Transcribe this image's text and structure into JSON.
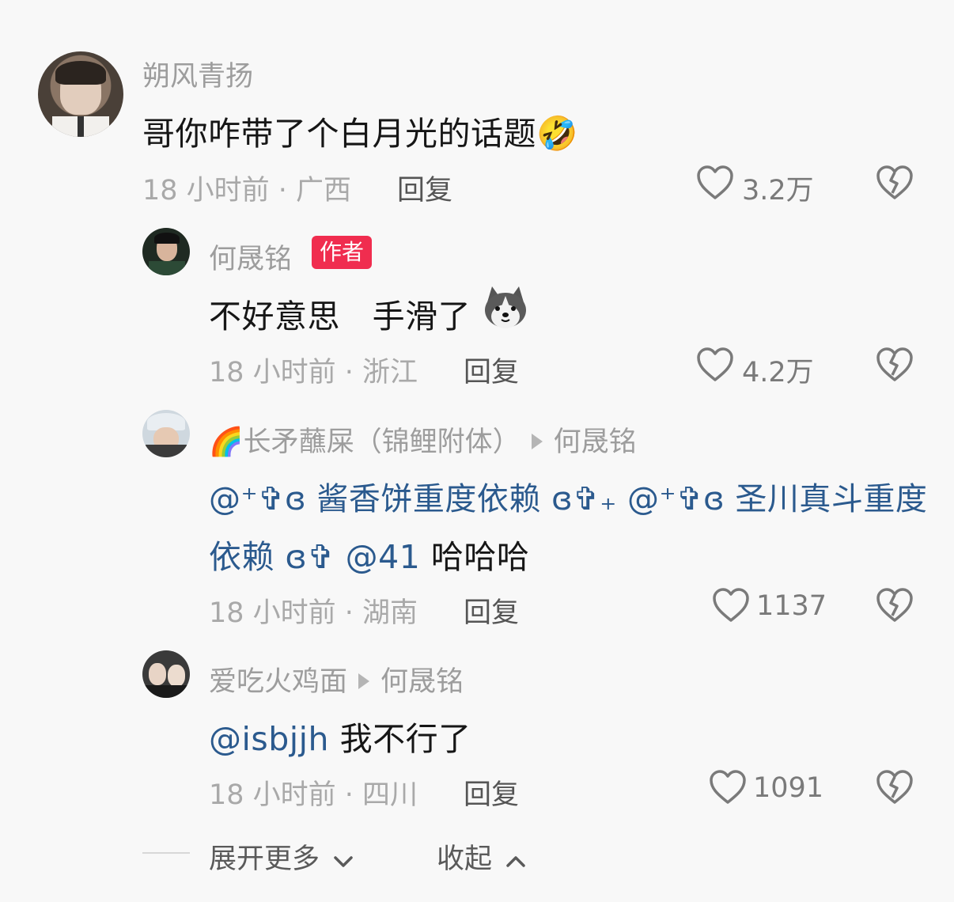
{
  "comments": [
    {
      "username": "朔风青扬",
      "text": "哥你咋带了个白月光的话题",
      "emoji": "🤣",
      "time_location": "18 小时前 · 广西",
      "reply_label": "回复",
      "likes": "3.2万",
      "replies": [
        {
          "username": "何晟铭",
          "badge": "作者",
          "text": "不好意思   手滑了",
          "time_location": "18 小时前 · 浙江",
          "reply_label": "回复",
          "likes": "4.2万"
        },
        {
          "user_prefix_emoji": "🌈",
          "username": "长矛蘸屎（锦鲤附体）",
          "reply_to": "何晟铭",
          "text_line1": "@⁺✞ɞ 酱香饼重度依赖 ɞ✞₊ @⁺✞ɞ 圣川真斗重度",
          "text_line2_mention": "依赖 ɞ✞ @41",
          "text_line2_rest": " 哈哈哈",
          "time_location": "18 小时前 · 湖南",
          "reply_label": "回复",
          "likes": "1137"
        },
        {
          "username": "爱吃火鸡面",
          "reply_to": "何晟铭",
          "mention": "@isbjjh",
          "text": " 我不行了",
          "time_location": "18 小时前 · 四川",
          "reply_label": "回复",
          "likes": "1091"
        }
      ]
    }
  ],
  "footer": {
    "expand_label": "展开更多",
    "collapse_label": "收起"
  },
  "icons": {
    "like": "heart-outline-icon",
    "dislike": "broken-heart-icon",
    "expand": "chevron-down-icon",
    "collapse": "chevron-up-icon"
  }
}
